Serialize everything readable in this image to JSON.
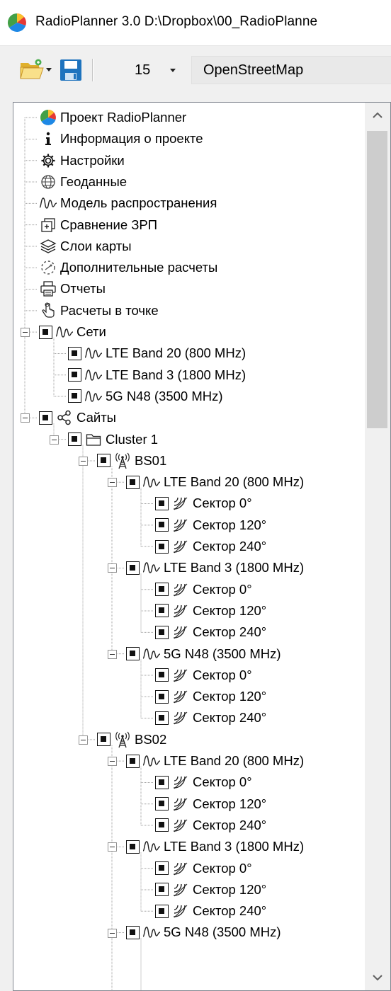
{
  "window": {
    "title": "RadioPlanner 3.0 D:\\Dropbox\\00_RadioPlanne",
    "logo_icon": "radioplanner-logo-icon"
  },
  "toolbar": {
    "open_icon": "folder-open-icon",
    "save_icon": "floppy-save-icon",
    "zoom_level": "15",
    "map_source": "OpenStreetMap"
  },
  "tree": {
    "items": [
      {
        "label": "Проект RadioPlanner",
        "icon": "project-ball-icon",
        "level": 0,
        "check": false,
        "expander": false
      },
      {
        "label": "Информация о проекте",
        "icon": "info-icon",
        "level": 0,
        "check": false,
        "expander": false
      },
      {
        "label": "Настройки",
        "icon": "gear-icon",
        "level": 0,
        "check": false,
        "expander": false
      },
      {
        "label": "Геоданные",
        "icon": "globe-icon",
        "level": 0,
        "check": false,
        "expander": false
      },
      {
        "label": "Модель распространения",
        "icon": "wave-icon",
        "level": 0,
        "check": false,
        "expander": false
      },
      {
        "label": "Сравнение ЗРП",
        "icon": "compare-icon",
        "level": 0,
        "check": false,
        "expander": false
      },
      {
        "label": "Слои карты",
        "icon": "layers-icon",
        "level": 0,
        "check": false,
        "expander": false
      },
      {
        "label": "Дополнительные расчеты",
        "icon": "dashed-circle-icon",
        "level": 0,
        "check": false,
        "expander": false
      },
      {
        "label": "Отчеты",
        "icon": "printer-icon",
        "level": 0,
        "check": false,
        "expander": false
      },
      {
        "label": "Расчеты в точке",
        "icon": "pointer-icon",
        "level": 0,
        "check": false,
        "expander": false
      },
      {
        "label": "Сети",
        "icon": "wave-icon",
        "level": 0,
        "check": true,
        "expander": true
      },
      {
        "label": "LTE Band 20 (800 MHz)",
        "icon": "wave-icon",
        "level": 1,
        "check": true,
        "expander": false
      },
      {
        "label": "LTE Band 3 (1800 MHz)",
        "icon": "wave-icon",
        "level": 1,
        "check": true,
        "expander": false
      },
      {
        "label": "5G N48 (3500 MHz)",
        "icon": "wave-icon",
        "level": 1,
        "check": true,
        "expander": false
      },
      {
        "label": "Сайты",
        "icon": "share-icon",
        "level": 0,
        "check": true,
        "expander": true
      },
      {
        "label": "Cluster 1",
        "icon": "folder-icon",
        "level": 1,
        "check": true,
        "expander": true
      },
      {
        "label": "BS01",
        "icon": "antenna-tower-icon",
        "level": 2,
        "check": true,
        "expander": true
      },
      {
        "label": "LTE Band 20 (800 MHz)",
        "icon": "wave-icon",
        "level": 3,
        "check": true,
        "expander": true
      },
      {
        "label": "Сектор 0°",
        "icon": "sector-icon",
        "level": 4,
        "check": true,
        "expander": false
      },
      {
        "label": "Сектор 120°",
        "icon": "sector-icon",
        "level": 4,
        "check": true,
        "expander": false
      },
      {
        "label": "Сектор 240°",
        "icon": "sector-icon",
        "level": 4,
        "check": true,
        "expander": false
      },
      {
        "label": "LTE Band 3 (1800 MHz)",
        "icon": "wave-icon",
        "level": 3,
        "check": true,
        "expander": true
      },
      {
        "label": "Сектор 0°",
        "icon": "sector-icon",
        "level": 4,
        "check": true,
        "expander": false
      },
      {
        "label": "Сектор 120°",
        "icon": "sector-icon",
        "level": 4,
        "check": true,
        "expander": false
      },
      {
        "label": "Сектор 240°",
        "icon": "sector-icon",
        "level": 4,
        "check": true,
        "expander": false
      },
      {
        "label": "5G N48 (3500 MHz)",
        "icon": "wave-icon",
        "level": 3,
        "check": true,
        "expander": true
      },
      {
        "label": "Сектор 0°",
        "icon": "sector-icon",
        "level": 4,
        "check": true,
        "expander": false
      },
      {
        "label": "Сектор 120°",
        "icon": "sector-icon",
        "level": 4,
        "check": true,
        "expander": false
      },
      {
        "label": "Сектор 240°",
        "icon": "sector-icon",
        "level": 4,
        "check": true,
        "expander": false
      },
      {
        "label": "BS02",
        "icon": "antenna-tower-icon",
        "level": 2,
        "check": true,
        "expander": true
      },
      {
        "label": "LTE Band 20 (800 MHz)",
        "icon": "wave-icon",
        "level": 3,
        "check": true,
        "expander": true
      },
      {
        "label": "Сектор 0°",
        "icon": "sector-icon",
        "level": 4,
        "check": true,
        "expander": false
      },
      {
        "label": "Сектор 120°",
        "icon": "sector-icon",
        "level": 4,
        "check": true,
        "expander": false
      },
      {
        "label": "Сектор 240°",
        "icon": "sector-icon",
        "level": 4,
        "check": true,
        "expander": false
      },
      {
        "label": "LTE Band 3 (1800 MHz)",
        "icon": "wave-icon",
        "level": 3,
        "check": true,
        "expander": true
      },
      {
        "label": "Сектор 0°",
        "icon": "sector-icon",
        "level": 4,
        "check": true,
        "expander": false
      },
      {
        "label": "Сектор 120°",
        "icon": "sector-icon",
        "level": 4,
        "check": true,
        "expander": false
      },
      {
        "label": "Сектор 240°",
        "icon": "sector-icon",
        "level": 4,
        "check": true,
        "expander": false
      },
      {
        "label": "5G N48 (3500 MHz)",
        "icon": "wave-icon",
        "level": 3,
        "check": true,
        "expander": true
      }
    ]
  },
  "scrollbar": {
    "up_icon": "scroll-up-icon",
    "down_icon": "scroll-down-icon"
  },
  "colors": {
    "accent": "#1e73be",
    "tree_line": "#a0a0a0",
    "panel_border": "#828790"
  }
}
